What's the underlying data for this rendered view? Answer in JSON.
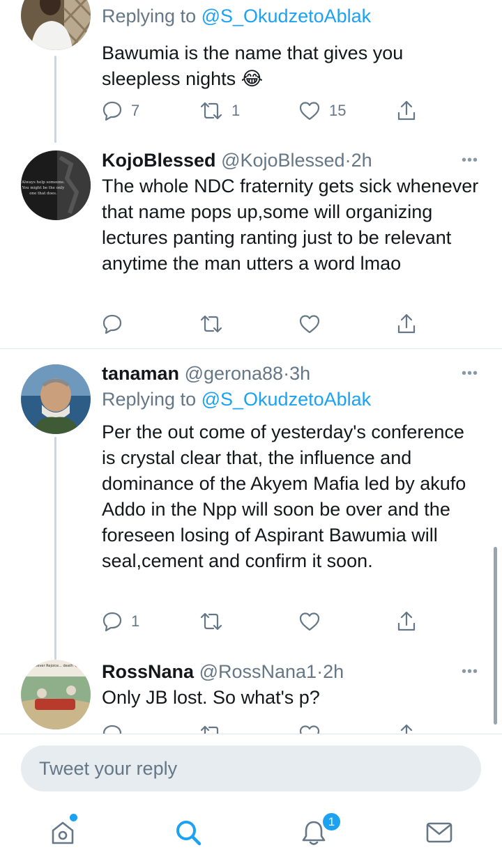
{
  "tweets": [
    {
      "replying_prefix": "Replying to",
      "replying_to": "@S_OkudzetoAblak",
      "text": "Bawumia is the name that gives you sleepless nights 😂",
      "reply_count": "7",
      "retweet_count": "1",
      "like_count": "15"
    },
    {
      "name": "KojoBlessed",
      "handle": "@KojoBlessed",
      "time": "2h",
      "text": "The whole NDC fraternity gets sick whenever that name pops up,some will organizing lectures panting ranting just to be relevant anytime the man utters a word lmao",
      "avatar_lines": [
        "Always help someone.",
        "You might be the only",
        "one that does."
      ]
    },
    {
      "name": "tanaman",
      "handle": "@gerona88",
      "time": "3h",
      "replying_prefix": "Replying to",
      "replying_to": "@S_OkudzetoAblak",
      "text": "Per the out come of yesterday's conference is crystal clear that, the influence and dominance of the Akyem Mafia led by akufo Addo in the Npp will soon be over  and the foreseen losing of Aspirant Bawumia will seal,cement and confirm it soon.",
      "reply_count": "1"
    },
    {
      "name": "RossNana",
      "handle": "@RossNana1",
      "time": "2h",
      "text": "Only JB lost. So what's p?",
      "avatar_caption": "...will never Rejoice... death 💔😂😂"
    }
  ],
  "separator": "·",
  "more_label": "•••",
  "reply_box": {
    "placeholder": "Tweet your reply"
  },
  "tabbar": {
    "items": [
      {
        "icon": "home-icon"
      },
      {
        "icon": "search-icon",
        "active": true
      },
      {
        "icon": "notifications-icon",
        "badge": "1"
      },
      {
        "icon": "messages-icon"
      }
    ]
  },
  "colors": {
    "accent": "#1da1f2",
    "text": "#14171a",
    "secondary": "#657786",
    "divider": "#e1e8ed",
    "input_bg": "#e6ecf0"
  }
}
